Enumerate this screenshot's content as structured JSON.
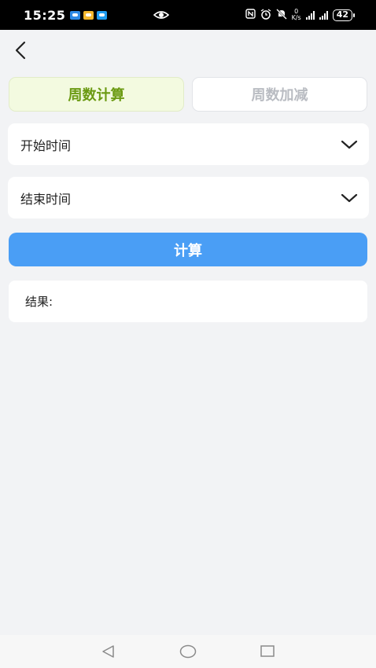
{
  "status_bar": {
    "time": "15:25",
    "net_speed_value": "0",
    "net_speed_unit": "K/s",
    "battery": "42",
    "notification_icons": [
      "message-icon",
      "email-icon",
      "cloud-icon"
    ]
  },
  "tabs": [
    {
      "label": "周数计算",
      "active": true
    },
    {
      "label": "周数加减",
      "active": false
    }
  ],
  "form": {
    "start_time_label": "开始时间",
    "end_time_label": "结束时间"
  },
  "calculate_button": "计算",
  "result": {
    "label": "结果:"
  },
  "colors": {
    "accent": "#4a9ef5",
    "active_tab_bg": "#f3fae0",
    "active_tab_text": "#6b9a12",
    "inactive_tab_text": "#b9bcc2",
    "background": "#f2f3f5"
  }
}
